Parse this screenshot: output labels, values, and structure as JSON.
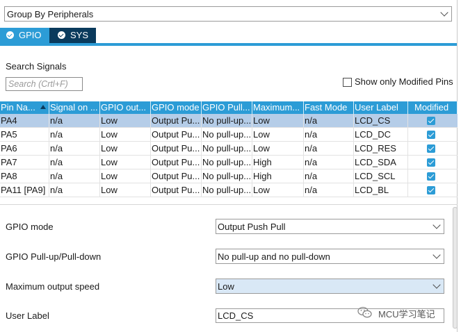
{
  "group_select": {
    "value": "Group By Peripherals"
  },
  "tabs": [
    {
      "label": "GPIO",
      "active": true
    },
    {
      "label": "SYS",
      "active": false
    }
  ],
  "search": {
    "label": "Search Signals",
    "placeholder": "Search (Crtl+F)"
  },
  "show_only_modified": {
    "label": "Show only Modified Pins",
    "checked": false
  },
  "table": {
    "columns": [
      "Pin Na...",
      "Signal on ...",
      "GPIO out...",
      "GPIO mode",
      "GPIO Pull...",
      "Maximum...",
      "Fast Mode",
      "User Label",
      "Modified"
    ],
    "rows": [
      [
        "PA4",
        "n/a",
        "Low",
        "Output Pu...",
        "No pull-up...",
        "Low",
        "n/a",
        "LCD_CS"
      ],
      [
        "PA5",
        "n/a",
        "Low",
        "Output Pu...",
        "No pull-up...",
        "Low",
        "n/a",
        "LCD_DC"
      ],
      [
        "PA6",
        "n/a",
        "Low",
        "Output Pu...",
        "No pull-up...",
        "Low",
        "n/a",
        "LCD_RES"
      ],
      [
        "PA7",
        "n/a",
        "Low",
        "Output Pu...",
        "No pull-up...",
        "High",
        "n/a",
        "LCD_SDA"
      ],
      [
        "PA8",
        "n/a",
        "Low",
        "Output Pu...",
        "No pull-up...",
        "High",
        "n/a",
        "LCD_SCL"
      ],
      [
        "PA11 [PA9]",
        "n/a",
        "Low",
        "Output Pu...",
        "No pull-up...",
        "Low",
        "n/a",
        "LCD_BL"
      ]
    ],
    "modified": [
      true,
      true,
      true,
      true,
      true,
      true
    ],
    "selected_row": 0
  },
  "properties": {
    "gpio_mode": {
      "label": "GPIO mode",
      "value": "Output Push Pull"
    },
    "gpio_pull": {
      "label": "GPIO Pull-up/Pull-down",
      "value": "No pull-up and no pull-down"
    },
    "max_speed": {
      "label": "Maximum output speed",
      "value": "Low"
    },
    "user_label": {
      "label": "User Label",
      "value": "LCD_CS"
    }
  },
  "watermark": {
    "text": "MCU学习笔记"
  },
  "colors": {
    "accent": "#2c9cd6",
    "tab_dark": "#0a3a5c",
    "selected_row": "#b5cde8",
    "highlight_field": "#d9e8f6"
  }
}
